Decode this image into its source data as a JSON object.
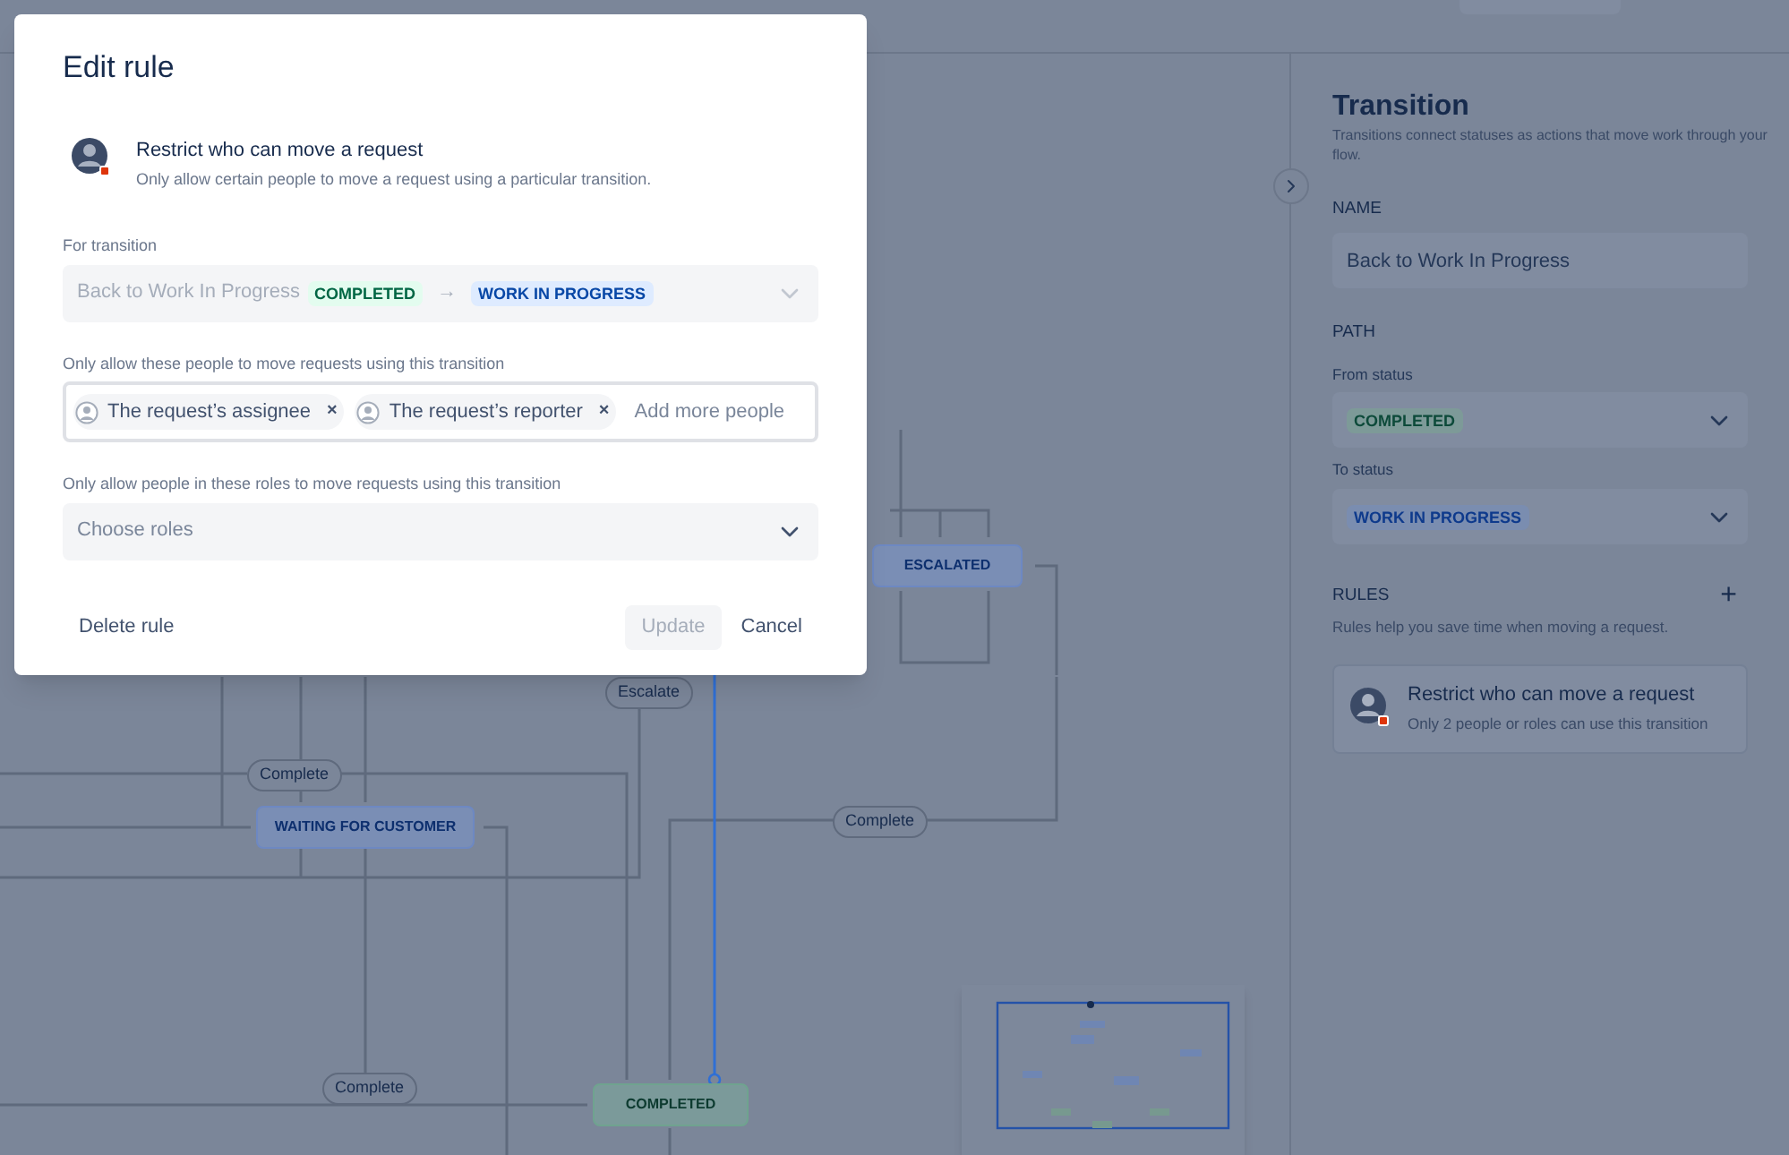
{
  "modal": {
    "title": "Edit rule",
    "rule": {
      "title": "Restrict who can move a request",
      "description": "Only allow certain people to move a request using a particular transition."
    },
    "transition_field": {
      "label": "For transition",
      "value": "Back to Work In Progress",
      "from_status": "COMPLETED",
      "arrow": "→",
      "to_status": "WORK IN PROGRESS"
    },
    "people_field": {
      "label": "Only allow these people to move requests using this transition",
      "people": [
        {
          "name": "The request’s assignee",
          "remove": "×"
        },
        {
          "name": "The request’s reporter",
          "remove": "×"
        }
      ],
      "placeholder": "Add more people"
    },
    "roles_field": {
      "label": "Only allow people in these roles to move requests using this transition",
      "placeholder": "Choose roles"
    },
    "buttons": [
      {
        "label": "Delete rule",
        "kind": "subtle",
        "disabled": false
      },
      {
        "label": "Update",
        "kind": "primary",
        "disabled": true
      },
      {
        "label": "Cancel",
        "kind": "subtle",
        "disabled": false
      }
    ]
  },
  "diagram": {
    "nodes": [
      {
        "label": "ESCALATED",
        "kind": "progress"
      },
      {
        "label": "WAITING FOR CUSTOMER",
        "kind": "progress"
      },
      {
        "label": "COMPLETED",
        "kind": "done"
      }
    ],
    "transitions": [
      "Escalate",
      "Complete",
      "Complete",
      "Complete"
    ]
  },
  "panel": {
    "title": "Transition",
    "description": "Transitions connect statuses as actions that move work through your flow.",
    "name_label": "NAME",
    "name_value": "Back to Work In Progress",
    "path_label": "PATH",
    "from_label": "From status",
    "from_status": "COMPLETED",
    "to_label": "To status",
    "to_status": "WORK IN PROGRESS",
    "rules_label": "RULES",
    "add": "+",
    "rules_description": "Rules help you save time when moving a request.",
    "rule_card": {
      "title": "Restrict who can move a request",
      "description": "Only 2 people or roles can use this transition"
    }
  }
}
